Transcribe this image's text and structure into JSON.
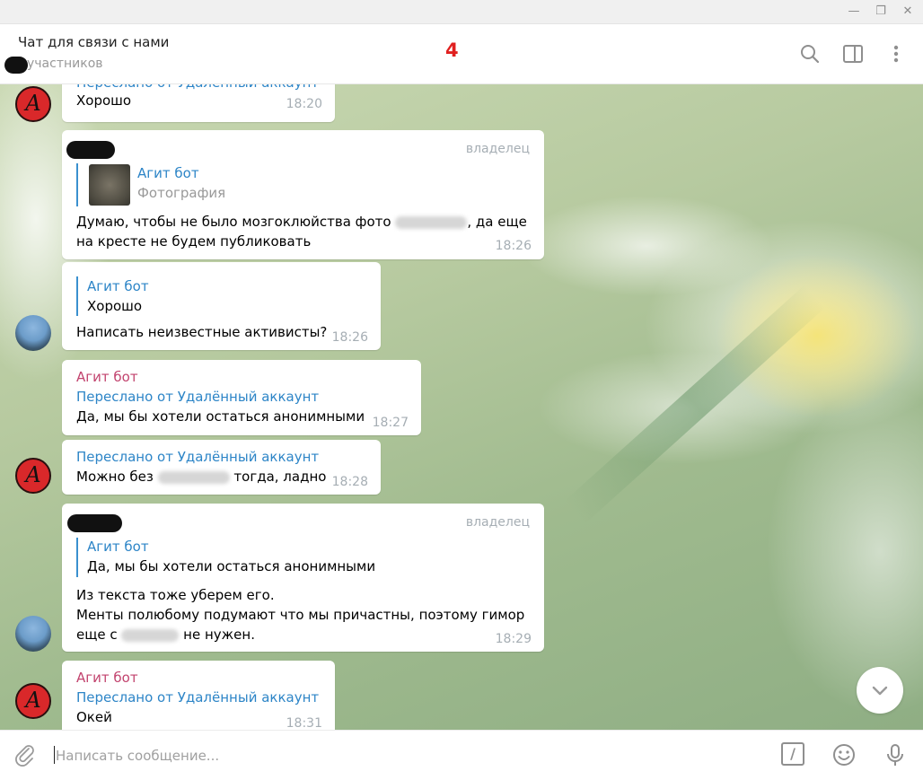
{
  "window": {
    "minimize_glyph": "—",
    "restore_glyph": "❐",
    "close_glyph": "✕"
  },
  "header": {
    "title": "Чат для связи с нами",
    "members": "участников",
    "overlay_number": "4",
    "icons": [
      "search-icon",
      "sidebar-toggle-icon",
      "more-vertical-icon"
    ]
  },
  "messages": [
    {
      "forwarded": "Переслано от Удалённый аккаунт",
      "text": "Хорошо",
      "time": "18:20"
    },
    {
      "role": "владелец",
      "reply_name": "Агит бот",
      "reply_text": "Фотография",
      "text_1a": "Думаю, чтобы не было мозгоклюйства фото",
      "text_1b": ", да еще",
      "text_2": "на кресте не будем публиковать",
      "time": "18:26"
    },
    {
      "reply_name": "Агит бот",
      "reply_text": "Хорошо",
      "text": "Написать неизвестные активисты?",
      "time": "18:26"
    },
    {
      "sender": "Агит бот",
      "forwarded": "Переслано от Удалённый аккаунт",
      "text": "Да, мы бы хотели остаться анонимными",
      "time": "18:27"
    },
    {
      "forwarded": "Переслано от Удалённый аккаунт",
      "text_a": "Можно без",
      "text_b": "тогда, ладно",
      "time": "18:28"
    },
    {
      "role": "владелец",
      "reply_name": "Агит бот",
      "reply_text": "Да, мы бы хотели остаться анонимными",
      "text_1": "Из текста тоже уберем его.",
      "text_2": "Менты полюбому подумают что мы причастны, поэтому гимор",
      "text_3a": "еще с",
      "text_3b": "не нужен.",
      "time": "18:29"
    },
    {
      "sender": "Агит бот",
      "forwarded": "Переслано от Удалённый аккаунт",
      "text": "Окей",
      "time": "18:31"
    }
  ],
  "avatar_letter": "A",
  "composer": {
    "placeholder": "Написать сообщение...",
    "commands_glyph": "/",
    "icons": [
      "attach-icon",
      "commands-icon",
      "emoji-icon",
      "microphone-icon"
    ]
  },
  "colors": {
    "link_blue": "#2d85c7",
    "bot_name": "#c2436e",
    "timestamp": "#a6aeb4",
    "overlay_red": "#e0201f"
  }
}
